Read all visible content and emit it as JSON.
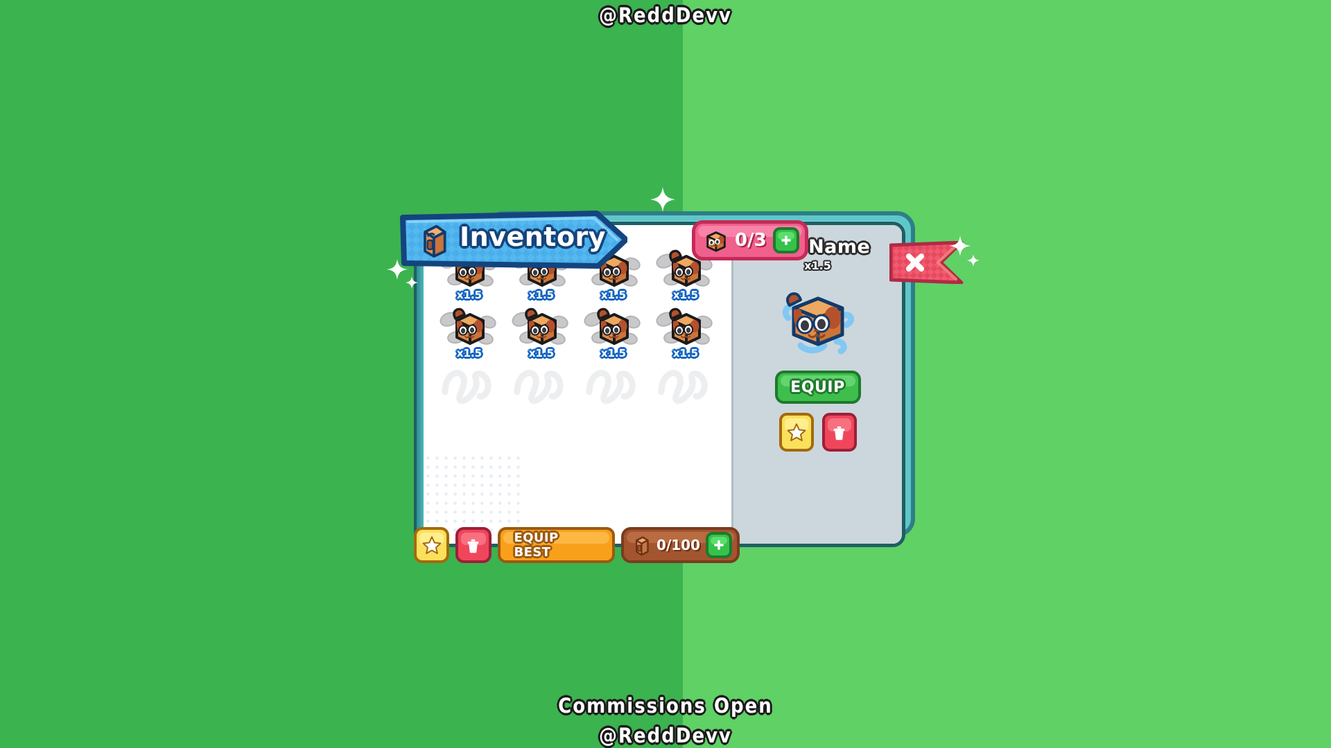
{
  "watermarks": {
    "top": "@ReddDevv",
    "bottom_line1": "Commissions Open",
    "bottom_line2": "@ReddDevv"
  },
  "colors": {
    "bg_left": "#3BB34F",
    "bg_right": "#5FD165",
    "banner_blue": "#49AEEA",
    "banner_outline": "#14447E",
    "panel_white": "#FFFFFF",
    "detail_gray": "#CBD7DD",
    "backdrop_teal": "#5FC6C9",
    "pink_pill": "#F0608C",
    "green_button": "#3FBE4E",
    "orange_button": "#F9A01B",
    "brown_pill": "#A3552F",
    "yellow_star": "#FBE05B",
    "red_trash": "#F0465B",
    "close_red": "#E8495F"
  },
  "banner": {
    "title": "Inventory",
    "icon": "backpack-icon"
  },
  "equipped_counter": {
    "icon": "pet-cube-icon",
    "value": "0/3",
    "add_label": "+"
  },
  "close_button": {
    "icon": "close-x-icon",
    "label": "X"
  },
  "grid": {
    "columns": 4,
    "rows": 3,
    "items": [
      {
        "icon": "pet-cube-dog",
        "multiplier": "x1.5",
        "empty": false
      },
      {
        "icon": "pet-cube-dog",
        "multiplier": "x1.5",
        "empty": false
      },
      {
        "icon": "pet-cube-dog",
        "multiplier": "x1.5",
        "empty": false
      },
      {
        "icon": "pet-cube-dog",
        "multiplier": "x1.5",
        "empty": false
      },
      {
        "icon": "pet-cube-dog",
        "multiplier": "x1.5",
        "empty": false
      },
      {
        "icon": "pet-cube-dog",
        "multiplier": "x1.5",
        "empty": false
      },
      {
        "icon": "pet-cube-dog",
        "multiplier": "x1.5",
        "empty": false
      },
      {
        "icon": "pet-cube-dog",
        "multiplier": "x1.5",
        "empty": false
      },
      {
        "icon": "squiggle-placeholder",
        "multiplier": "",
        "empty": true
      },
      {
        "icon": "squiggle-placeholder",
        "multiplier": "",
        "empty": true
      },
      {
        "icon": "squiggle-placeholder",
        "multiplier": "",
        "empty": true
      },
      {
        "icon": "squiggle-placeholder",
        "multiplier": "",
        "empty": true
      }
    ]
  },
  "toolbar": {
    "favorite_icon": "star-icon",
    "delete_icon": "trash-icon",
    "equip_best_label": "EQUIP BEST",
    "capacity_icon": "backpack-icon",
    "capacity_value": "0/100",
    "capacity_add_label": "+"
  },
  "detail": {
    "pet_name": "Pet Name",
    "multiplier": "x1.5",
    "pet_icon": "pet-cube-dog-large",
    "equip_label": "EQUIP",
    "favorite_icon": "star-icon",
    "delete_icon": "trash-icon"
  }
}
